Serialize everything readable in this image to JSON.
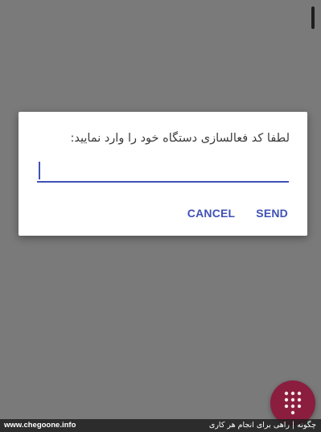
{
  "dialog": {
    "message": "لطفا کد فعالسازی دستگاه خود را وارد نمایید:",
    "input_value": "",
    "cancel_label": "CANCEL",
    "send_label": "SEND"
  },
  "fab": {
    "icon": "dialpad-icon"
  },
  "footer": {
    "site": "www.chegoone.info",
    "tagline": "چگونه | راهی برای انجام هر کاری"
  },
  "colors": {
    "accent": "#3f51b5",
    "fab": "#8b1d3e",
    "scrim": "#7a7a7a"
  }
}
